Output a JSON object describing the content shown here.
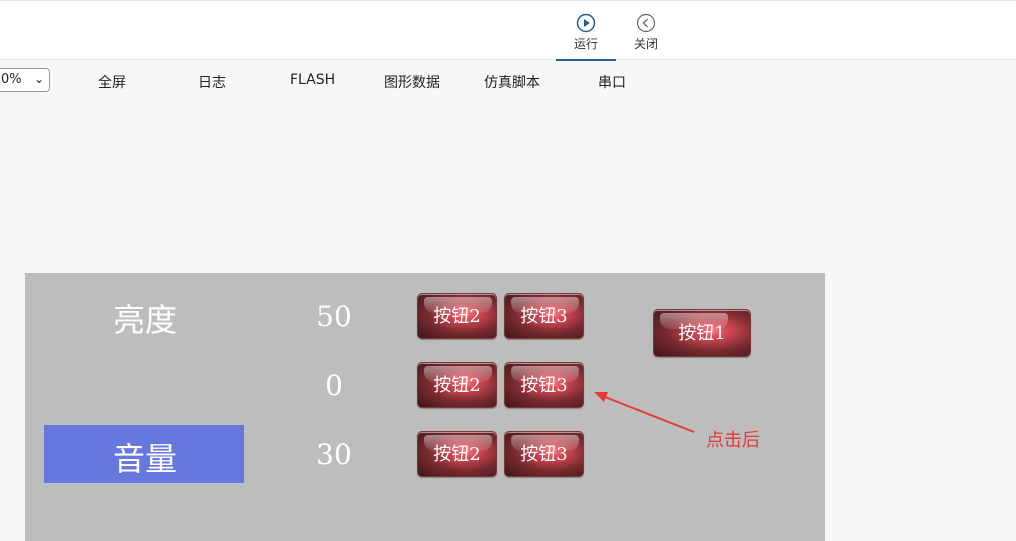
{
  "toolbar": {
    "run_label": "运行",
    "close_label": "关闭",
    "accent": "#2a5d8f"
  },
  "menu": {
    "zoom_value": "0%",
    "items": [
      "全屏",
      "日志",
      "FLASH",
      "图形数据",
      "仿真脚本",
      "串口"
    ]
  },
  "panel": {
    "brightness_label": "亮度",
    "volume_label": "音量",
    "values": [
      "50",
      "0",
      "30"
    ],
    "button_rows": [
      [
        "按钮2",
        "按钮3"
      ],
      [
        "按钮2",
        "按钮3"
      ],
      [
        "按钮2",
        "按钮3"
      ]
    ],
    "button1_label": "按钮1",
    "background": "#bdbdbd",
    "highlight": "#6677dd"
  },
  "annotation": {
    "text": "点击后",
    "color": "#e53935"
  }
}
